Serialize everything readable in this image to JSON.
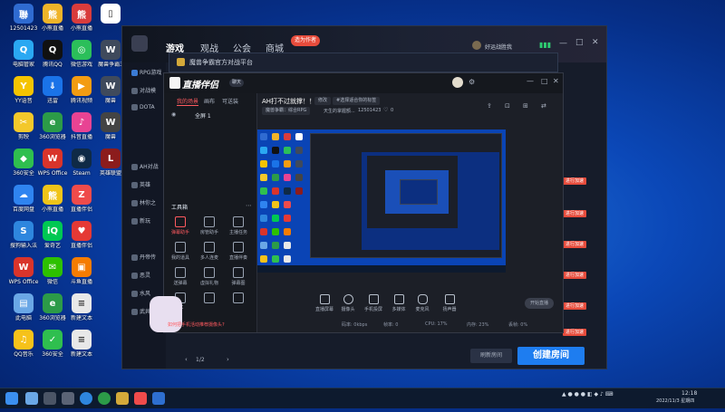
{
  "desktop": {
    "top_user_label": "12501423",
    "icons": [
      {
        "label": "12501423",
        "color": "#2f6bd1",
        "glyph": "聯"
      },
      {
        "label": "小熊直播",
        "color": "#f0b429",
        "glyph": "熊"
      },
      {
        "label": "小熊直播",
        "color": "#d93c3c",
        "glyph": "熊"
      },
      {
        "label": "",
        "color": "#ffffff",
        "glyph": "▯"
      },
      {
        "label": "电脑管家",
        "color": "#2aa8f2",
        "glyph": "Q"
      },
      {
        "label": "腾讯QQ",
        "color": "#111111",
        "glyph": "Q"
      },
      {
        "label": "微信游戏",
        "color": "#2bbf5a",
        "glyph": "◎"
      },
      {
        "label": "魔兽争霸3",
        "color": "#3f4a5c",
        "glyph": "W"
      },
      {
        "label": "YY语音",
        "color": "#f5c400",
        "glyph": "Y"
      },
      {
        "label": "迅雷",
        "color": "#1a73e8",
        "glyph": "⇓"
      },
      {
        "label": "腾讯视频",
        "color": "#f39c12",
        "glyph": "▶"
      },
      {
        "label": "魔兽",
        "color": "#3f4a5c",
        "glyph": "W"
      },
      {
        "label": "剪映",
        "color": "#f3c82b",
        "glyph": "✂"
      },
      {
        "label": "360浏览器",
        "color": "#2c9b48",
        "glyph": "e"
      },
      {
        "label": "抖音直播",
        "color": "#e84393",
        "glyph": "♪"
      },
      {
        "label": "魔兽",
        "color": "#444444",
        "glyph": "W"
      },
      {
        "label": "360安全",
        "color": "#2fbf4f",
        "glyph": "◆"
      },
      {
        "label": "WPS Office",
        "color": "#d9342b",
        "glyph": "W"
      },
      {
        "label": "Steam",
        "color": "#0f2a46",
        "glyph": "◉"
      },
      {
        "label": "英雄联盟",
        "color": "#8c1c1c",
        "glyph": "L"
      },
      {
        "label": "百度网盘",
        "color": "#2f84f0",
        "glyph": "☁"
      },
      {
        "label": "小熊直播",
        "color": "#f0c419",
        "glyph": "熊"
      },
      {
        "label": "直播伴侣",
        "color": "#ef4b4b",
        "glyph": "Z"
      },
      {
        "label": "",
        "color": "#000000",
        "glyph": ""
      },
      {
        "label": "搜狗输入法",
        "color": "#2e86de",
        "glyph": "S"
      },
      {
        "label": "爱奇艺",
        "color": "#00c853",
        "glyph": "iQ"
      },
      {
        "label": "直播伴侣",
        "color": "#e53935",
        "glyph": "♥"
      },
      {
        "label": "",
        "color": "#000000",
        "glyph": ""
      },
      {
        "label": "WPS Office",
        "color": "#d9342b",
        "glyph": "W"
      },
      {
        "label": "微信",
        "color": "#2dc100",
        "glyph": "✉"
      },
      {
        "label": "斗鱼直播",
        "color": "#f57c00",
        "glyph": "▣"
      },
      {
        "label": "",
        "color": "#000000",
        "glyph": ""
      },
      {
        "label": "此电脑",
        "color": "#6aa7e6",
        "glyph": "▤"
      },
      {
        "label": "360浏览器",
        "color": "#2c9b48",
        "glyph": "e"
      },
      {
        "label": "新建文本",
        "color": "#e8e8e8",
        "glyph": "≡"
      },
      {
        "label": "",
        "color": "#000000",
        "glyph": ""
      },
      {
        "label": "QQ音乐",
        "color": "#f6c21a",
        "glyph": "♫"
      },
      {
        "label": "360安全",
        "color": "#2fbf4f",
        "glyph": "✓"
      },
      {
        "label": "新建文本",
        "color": "#e8e8e8",
        "glyph": "≡"
      }
    ]
  },
  "launcher": {
    "nav": [
      "游戏",
      "观战",
      "公会",
      "商城"
    ],
    "promo_badge": "造为作者",
    "username": "好运战胜我",
    "sidebar": [
      "RPG游戏",
      "对战模",
      "DOTA",
      "AH对战",
      "英雄",
      "林你之",
      "新玩",
      "丹帝传",
      "恶灵",
      "水风",
      "武井"
    ],
    "red_tags": [
      "进行加速",
      "进行加速",
      "进行加速",
      "进行加速",
      "进行加速",
      "进行加速"
    ],
    "cancel_button": "刷新房间",
    "create_button": "创建房间",
    "pager": "1/2"
  },
  "middle_window": {
    "title": "魔兽争霸官方对战平台"
  },
  "stream_app": {
    "title": "直播伴侣",
    "title_badge": "聊天",
    "left_tabs": [
      "我的场景",
      "画布",
      "可送装"
    ],
    "scene_label": "全屏 1",
    "tools_title": "工具箱",
    "tools": [
      "弹幕助手",
      "房管助手",
      "主播任务",
      "我的道具",
      "多人连麦",
      "直播伴奏",
      "送弹幕",
      "虚拟礼物",
      "弹幕图",
      "PK",
      "",
      ""
    ],
    "notice": "如何把手机活动推荐摄像头?",
    "stream_title": "AH打不过就撑！！",
    "tag_a": "修改",
    "tag_b": "#选择适合你的标签",
    "game_name": "魔兽争霸：综合RPG",
    "channel": "天生的掌握额...",
    "room_id": "12501423",
    "likes": "0",
    "controls": [
      "直播屏幕",
      "摄像头",
      "手机投屏",
      "多媒体",
      "麦克风",
      "扬声器"
    ],
    "start_button": "开始直播",
    "stats": [
      "码率: 0kbps",
      "帧率: 0",
      "CPU: 17%",
      "内存: 23%",
      "丢帧: 0%"
    ]
  },
  "taskbar": {
    "time": "12:18",
    "date": "2022/11/3 星期四"
  }
}
